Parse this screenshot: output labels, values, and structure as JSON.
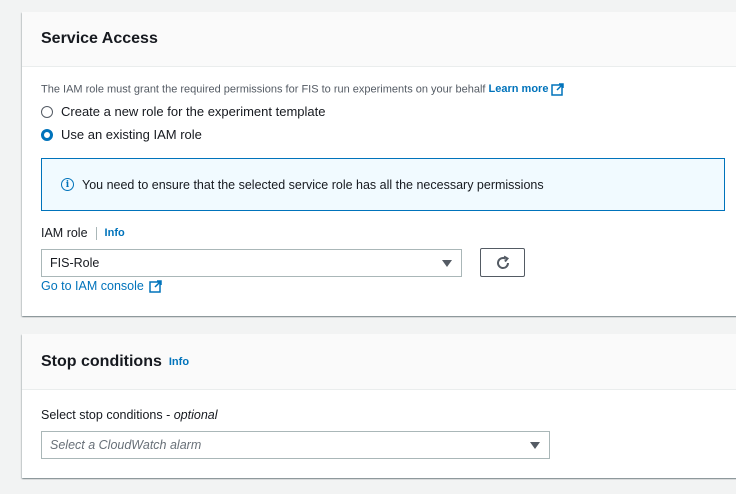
{
  "service_access": {
    "title": "Service Access",
    "description": "The IAM role must grant the required permissions for FIS to run experiments on your behalf",
    "learn_more": "Learn more",
    "radio_options": [
      {
        "label": "Create a new role for the experiment template",
        "checked": false
      },
      {
        "label": "Use an existing IAM role",
        "checked": true
      }
    ],
    "alert_text": "You need to ensure that the selected service role has all the necessary permissions",
    "iam_role_label": "IAM role",
    "info_link": "Info",
    "iam_role_value": "FIS-Role",
    "console_link": "Go to IAM console"
  },
  "stop_conditions": {
    "title": "Stop conditions",
    "info_link": "Info",
    "field_label": "Select stop conditions - ",
    "field_optional": "optional",
    "placeholder": "Select a CloudWatch alarm"
  },
  "icons": {
    "external": "external-link-icon",
    "refresh": "refresh-icon",
    "info": "info-icon",
    "caret": "caret-down-icon"
  },
  "colors": {
    "link": "#0073bb",
    "alert_bg": "#f1faff",
    "alert_border": "#0073bb"
  }
}
